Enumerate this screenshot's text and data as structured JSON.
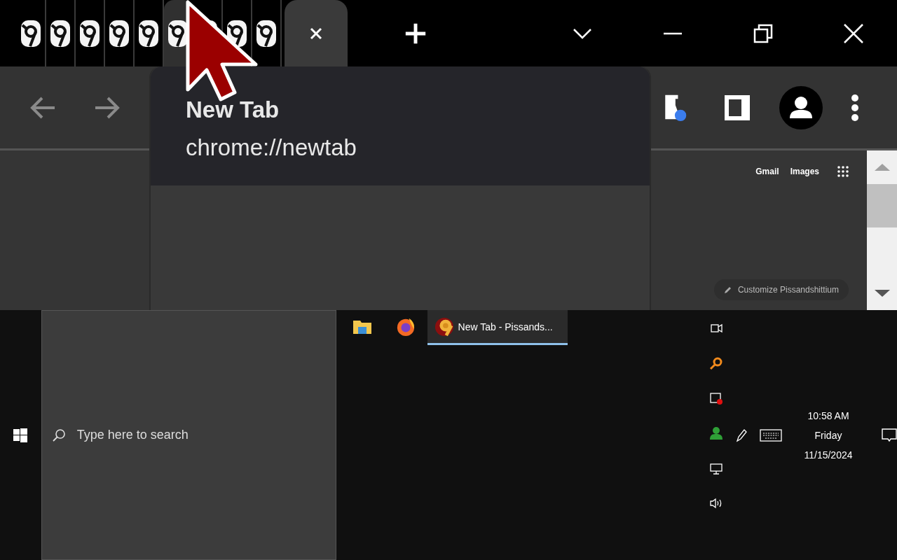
{
  "tabs": [
    {
      "selected": false,
      "hovered": false
    },
    {
      "selected": false,
      "hovered": false
    },
    {
      "selected": false,
      "hovered": false
    },
    {
      "selected": false,
      "hovered": false
    },
    {
      "selected": false,
      "hovered": false
    },
    {
      "selected": false,
      "hovered": true
    },
    {
      "selected": false,
      "hovered": false
    },
    {
      "selected": false,
      "hovered": false
    },
    {
      "selected": false,
      "hovered": false
    },
    {
      "selected": true
    }
  ],
  "tooltip": {
    "title": "New Tab",
    "url": "chrome://newtab"
  },
  "page": {
    "links": [
      "Gmail",
      "Images"
    ],
    "customize": "Customize Pissandshittium"
  },
  "taskbar": {
    "search": {
      "placeholder": "Type here to search"
    },
    "apps": [
      {
        "kind": "folder",
        "selected": false
      },
      {
        "kind": "firefox",
        "selected": false
      },
      {
        "kind": "chrome",
        "label": "New Tab - Pissands...",
        "selected": true
      }
    ],
    "clock": {
      "time": "10:58 AM",
      "day": "Friday",
      "date": "11/15/2024"
    }
  }
}
